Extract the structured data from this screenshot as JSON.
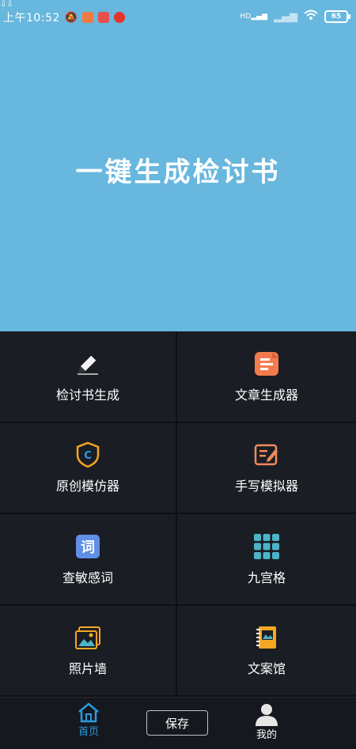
{
  "status_bar": {
    "time": "上午10:52",
    "battery": "65",
    "network": "HD"
  },
  "hero": {
    "title": "一键生成检讨书"
  },
  "grid": [
    {
      "label": "检讨书生成",
      "icon": "pencil-icon"
    },
    {
      "label": "文章生成器",
      "icon": "document-icon"
    },
    {
      "label": "原创模仿器",
      "icon": "shield-c-icon"
    },
    {
      "label": "手写模拟器",
      "icon": "edit-note-icon"
    },
    {
      "label": "查敏感词",
      "icon": "word-ci-icon"
    },
    {
      "label": "九宫格",
      "icon": "grid-nine-icon"
    },
    {
      "label": "照片墙",
      "icon": "photos-icon"
    },
    {
      "label": "文案馆",
      "icon": "notebook-icon"
    }
  ],
  "bottom_nav": {
    "home_label": "首页",
    "save_label": "保存",
    "me_label": "我的"
  },
  "colors": {
    "hero_bg": "#67b7de",
    "panel_bg": "#1a1d24",
    "accent_blue": "#2a9be0",
    "orange": "#f5a623",
    "coral": "#f08a5d"
  }
}
